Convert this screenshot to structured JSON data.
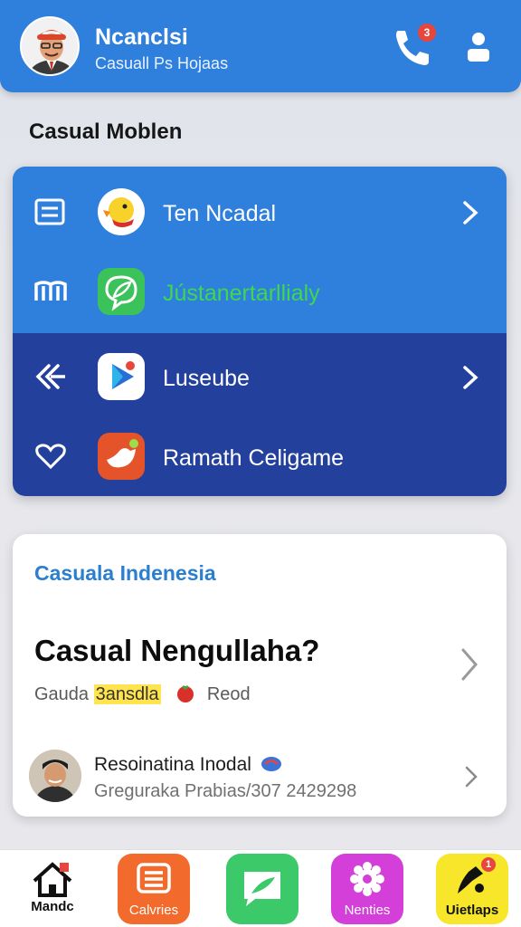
{
  "header": {
    "title": "Ncanclsi",
    "subtitle": "Casuall Ps Hojaas",
    "notification_count": "3",
    "brand_color": "#2f7fdc"
  },
  "section": {
    "title": "Casual Moblen"
  },
  "menu": {
    "items": [
      {
        "label": "Ten Ncadal",
        "lead_icon": "list-icon",
        "app_icon": "duck-icon",
        "chevron": true
      },
      {
        "label": "Jústanertarllialy",
        "lead_icon": "book-icon",
        "app_icon": "chat-leaf-icon",
        "chevron": false,
        "label_color": "#3ed84f"
      },
      {
        "label": "Luseube",
        "lead_icon": "back-arrows-icon",
        "app_icon": "play-icon",
        "chevron": true
      },
      {
        "label": "Ramath Celigame",
        "lead_icon": "heart-icon",
        "app_icon": "bird-icon",
        "chevron": false
      }
    ],
    "top_color": "#2f7fdc",
    "bottom_color": "#23409d"
  },
  "info": {
    "subtitle": "Casuala Indenesia",
    "question": "Casual Nengullaha?",
    "tag_plain": "Gauda",
    "tag_highlight": "3ansdla",
    "tag_end": "Reod",
    "contact_name": "Resoinatina Inodal",
    "contact_detail": "Greguraka Prabias/307 2429298"
  },
  "nav": {
    "items": [
      {
        "label": "Mandc",
        "icon": "home-icon",
        "color": "#ffffff"
      },
      {
        "label": "Calvries",
        "icon": "list-icon",
        "color": "#f26a2c"
      },
      {
        "label": "",
        "icon": "chat-icon",
        "color": "#3cc96a"
      },
      {
        "label": "Nenties",
        "icon": "gear-icon",
        "color": "#d43ed9"
      },
      {
        "label": "Uietlaps",
        "icon": "music-icon",
        "color": "#f7e62a",
        "badge": "1"
      }
    ]
  }
}
